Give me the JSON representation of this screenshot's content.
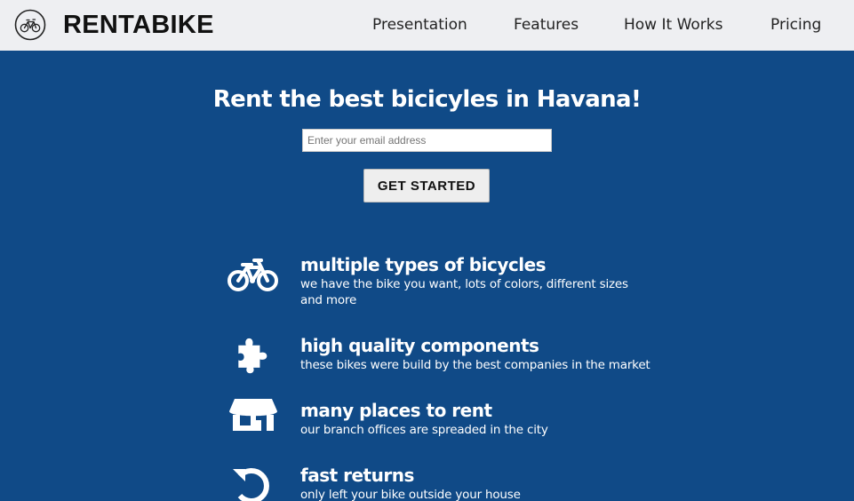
{
  "header": {
    "brand": "RENTABIKE",
    "logo_icon": "bicycle-circle-icon",
    "nav": [
      {
        "label": "Presentation"
      },
      {
        "label": "Features"
      },
      {
        "label": "How It Works"
      },
      {
        "label": "Pricing"
      }
    ]
  },
  "hero": {
    "title": "Rent the best bicicyles in Havana!",
    "email": {
      "value": "",
      "placeholder": "Enter your email address"
    },
    "cta_label": "GET STARTED"
  },
  "features": [
    {
      "icon": "bicycle-icon",
      "title": "multiple types of bicycles",
      "description": "we have the bike you want, lots of colors, different sizes and more"
    },
    {
      "icon": "puzzle-piece-icon",
      "title": "high quality components",
      "description": "these bikes were build by the best companies in the market"
    },
    {
      "icon": "store-icon",
      "title": "many places to rent",
      "description": "our branch offices are spreaded in the city"
    },
    {
      "icon": "undo-icon",
      "title": "fast returns",
      "description": "only left your bike outside your house"
    }
  ],
  "colors": {
    "header_bg": "#eeeff2",
    "hero_bg": "#104a87",
    "text_light": "#ffffff",
    "text_dark": "#111111"
  }
}
